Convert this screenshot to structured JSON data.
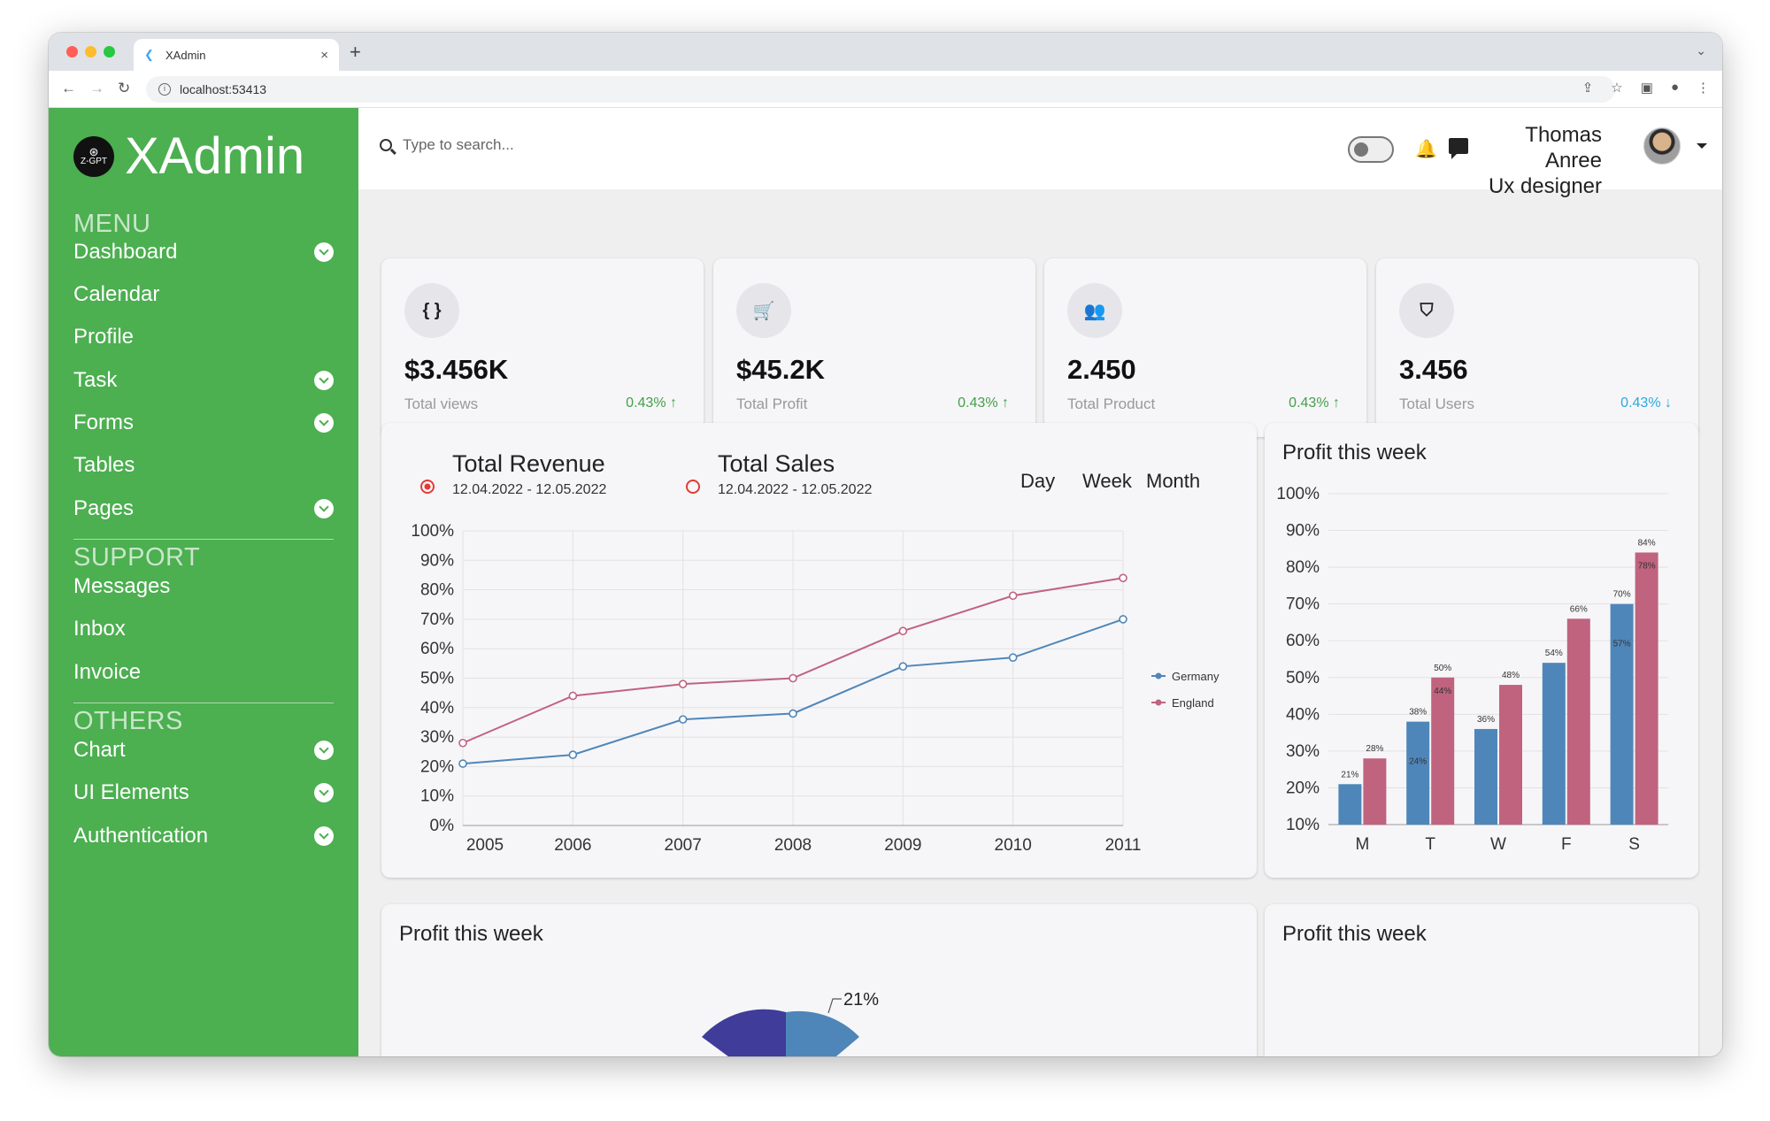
{
  "browser": {
    "tab_title": "XAdmin",
    "url": "localhost:53413",
    "dot_colors": [
      "#ff5f57",
      "#febc2e",
      "#28c840"
    ]
  },
  "sidebar": {
    "logo_badge": "Z-GPT",
    "brand": "XAdmin",
    "accent": "#4caf50",
    "sections": [
      {
        "title": "MENU",
        "items": [
          {
            "label": "Dashboard",
            "expandable": true
          },
          {
            "label": "Calendar",
            "expandable": false
          },
          {
            "label": "Profile",
            "expandable": false
          },
          {
            "label": "Task",
            "expandable": true
          },
          {
            "label": "Forms",
            "expandable": true
          },
          {
            "label": "Tables",
            "expandable": false
          },
          {
            "label": "Pages",
            "expandable": true
          }
        ]
      },
      {
        "title": "SUPPORT",
        "items": [
          {
            "label": "Messages",
            "expandable": false
          },
          {
            "label": "Inbox",
            "expandable": false
          },
          {
            "label": "Invoice",
            "expandable": false
          }
        ]
      },
      {
        "title": "OTHERS",
        "items": [
          {
            "label": "Chart",
            "expandable": true
          },
          {
            "label": "UI Elements",
            "expandable": true
          },
          {
            "label": "Authentication",
            "expandable": true
          }
        ]
      }
    ]
  },
  "header": {
    "search_placeholder": "Type to search...",
    "user_name": "Thomas Anree",
    "user_role": "Ux designer"
  },
  "stats": [
    {
      "icon": "eye-icon",
      "glyph": "{ }",
      "value": "$3.456K",
      "label": "Total views",
      "change": "0.43%",
      "trend": "up",
      "color": "#43a047"
    },
    {
      "icon": "cart-icon",
      "glyph": "🛒",
      "value": "$45.2K",
      "label": "Total Profit",
      "change": "0.43%",
      "trend": "up",
      "color": "#43a047"
    },
    {
      "icon": "users-icon",
      "glyph": "👥",
      "value": "2.450",
      "label": "Total Product",
      "change": "0.43%",
      "trend": "up",
      "color": "#43a047"
    },
    {
      "icon": "shield-icon",
      "glyph": "⛉",
      "value": "3.456",
      "label": "Total Users",
      "change": "0.43%",
      "trend": "down",
      "color": "#29a9e0"
    }
  ],
  "revenue_card": {
    "legend_1_title": "Total Revenue",
    "legend_1_dates": "12.04.2022 - 12.05.2022",
    "legend_2_title": "Total Sales",
    "legend_2_dates": "12.04.2022 - 12.05.2022",
    "range_buttons": [
      "Day",
      "Week",
      "Month"
    ]
  },
  "profit_card_titles": [
    "Profit this week",
    "Profit this week",
    "Profit this week"
  ],
  "pie_partial_label": "21%",
  "chart_data": [
    {
      "type": "line",
      "x": [
        "2005",
        "2006",
        "2007",
        "2008",
        "2009",
        "2010",
        "2011"
      ],
      "ylim": [
        0,
        100
      ],
      "yticks": [
        "0%",
        "10%",
        "20%",
        "30%",
        "40%",
        "50%",
        "60%",
        "70%",
        "80%",
        "90%",
        "100%"
      ],
      "series": [
        {
          "name": "Germany",
          "color": "#4f86b9",
          "values": [
            21,
            24,
            36,
            38,
            54,
            57,
            70
          ]
        },
        {
          "name": "England",
          "color": "#c0637f",
          "values": [
            28,
            44,
            48,
            50,
            66,
            78,
            84
          ]
        }
      ],
      "grid": true,
      "legend": "right"
    },
    {
      "type": "bar",
      "title": "Profit this week",
      "categories": [
        "M",
        "T",
        "W",
        "F",
        "S"
      ],
      "ylim": [
        10,
        100
      ],
      "yticks": [
        "10%",
        "20%",
        "30%",
        "40%",
        "50%",
        "60%",
        "70%",
        "80%",
        "90%",
        "100%"
      ],
      "series": [
        {
          "color": "#4f86b9",
          "values": [
            21,
            38,
            36,
            54,
            70
          ],
          "labels": [
            "21%",
            "38%",
            "36%",
            "54%",
            "70%"
          ]
        },
        {
          "color": "#c0637f",
          "values": [
            28,
            50,
            48,
            66,
            84
          ],
          "labels": [
            "28%",
            "50%",
            "48%",
            "66%",
            "84%"
          ]
        }
      ],
      "inner_labels": [
        "",
        "24%",
        "",
        "",
        "57%",
        "",
        "44%",
        "",
        "",
        "78%"
      ]
    }
  ]
}
